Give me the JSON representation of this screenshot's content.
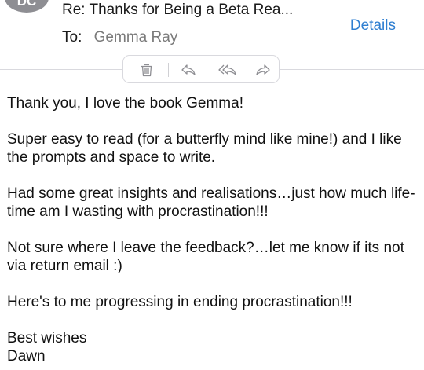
{
  "header": {
    "avatar_initials": "DC",
    "subject": "Re: Thanks for Being a Beta Rea...",
    "to_label": "To:",
    "to_name": "Gemma Ray",
    "details_label": "Details"
  },
  "toolbar": {
    "icons": [
      "trash-icon",
      "reply-icon",
      "reply-all-icon",
      "forward-icon"
    ]
  },
  "message": {
    "greeting": "Thank you, I love the book Gemma!",
    "para1": "Super easy to read (for a butterfly mind like mine!) and I like the prompts and space to write.",
    "para2": "Had some great insights and realisations…just how much life-time am I wasting with procrastination!!!",
    "para3": "Not sure where I leave the feedback?…let me know if its not via return email :)",
    "para4": "Here's to me progressing in ending procrastination!!!",
    "signoff": "Best wishes",
    "signature": "Dawn"
  },
  "colors": {
    "accent": "#2f7fd1",
    "secondary_text": "#7a7a7a",
    "icon_gray": "#8e8e93",
    "divider": "#d9d9de"
  }
}
